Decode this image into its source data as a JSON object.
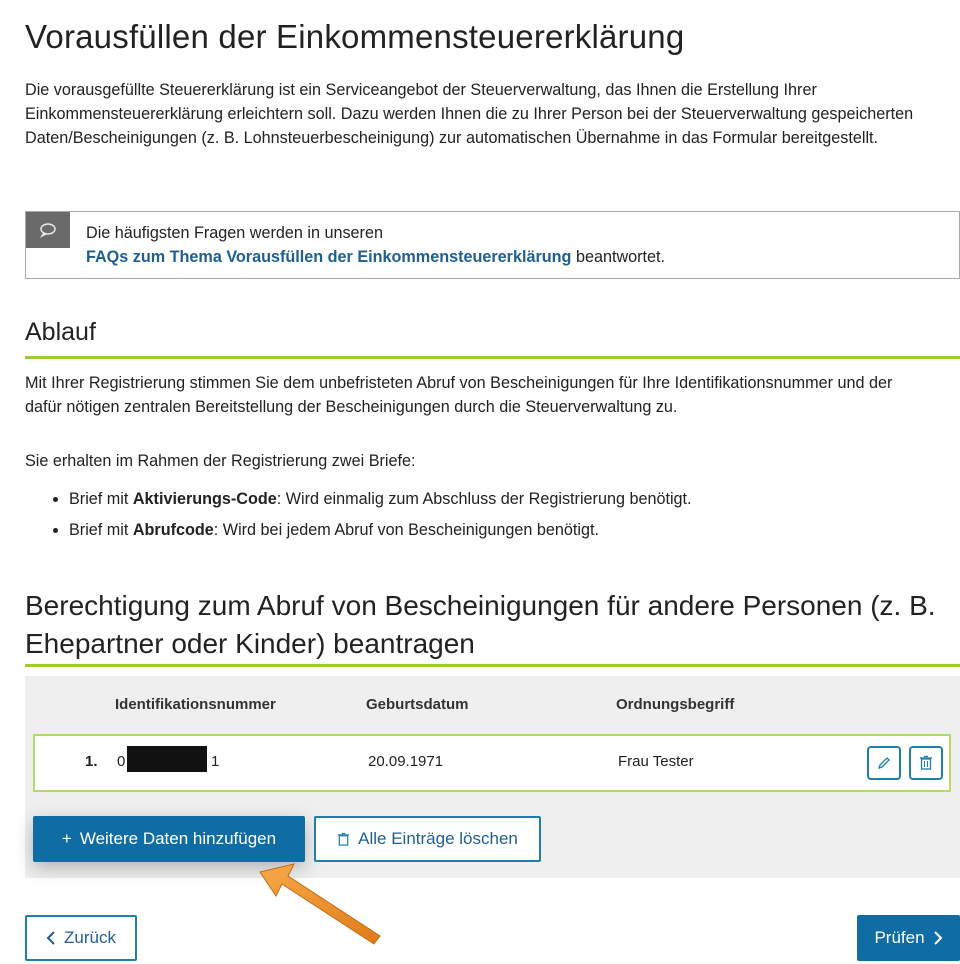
{
  "page": {
    "title": "Vorausfüllen der Einkommensteuererklärung",
    "intro": "Die vorausgefüllte Steuererklärung ist ein Serviceangebot der Steuerverwaltung, das Ihnen die Erstellung Ihrer Einkommensteuererklärung erleichtern soll. Dazu werden Ihnen die zu Ihrer Person bei der Steuerverwaltung gespeicherten Daten/Bescheinigungen (z. B. Lohnsteuerbescheinigung) zur automatischen Übernahme in das Formular bereitgestellt."
  },
  "infobox": {
    "icon": "speech-bubble-icon",
    "line1": "Die häufigsten Fragen werden in unseren",
    "link": "FAQs zum Thema Vorausfüllen der Einkommensteuererklärung",
    "line2_suffix": " beantwortet."
  },
  "ablauf": {
    "heading": "Ablauf",
    "text": "Mit Ihrer Registrierung stimmen Sie dem unbefristeten Abruf von Bescheinigungen für Ihre Identifikationsnummer und der dafür nötigen zentralen Bereitstellung der Bescheinigungen durch die Steuerverwaltung zu.",
    "text2": "Sie erhalten im Rahmen der Registrierung zwei Briefe:",
    "items": [
      {
        "prefix": "Brief mit ",
        "bold": "Aktivierungs-Code",
        "suffix": ": Wird einmalig zum Abschluss der Registrierung benötigt."
      },
      {
        "prefix": "Brief mit ",
        "bold": "Abrufcode",
        "suffix": ": Wird bei jedem Abruf von Bescheinigungen benötigt."
      }
    ]
  },
  "berechtigung": {
    "heading": "Berechtigung zum Abruf von Bescheinigungen für andere Personen (z. B. Ehepartner oder Kinder) beantragen",
    "columns": [
      "Identifikationsnummer",
      "Geburtsdatum",
      "Ordnungsbegriff"
    ],
    "rows": [
      {
        "index": "1.",
        "id_start": "0",
        "id_end": "1",
        "dob": "20.09.1971",
        "ord": "Frau Tester"
      }
    ],
    "add_button": "Weitere Daten hinzufügen",
    "add_icon": "+",
    "clear_button": "Alle Einträge löschen"
  },
  "nav": {
    "back": "Zurück",
    "next": "Prüfen"
  },
  "colors": {
    "accent": "#0f6da3",
    "green": "#9acd32",
    "arrow": "#f08a24"
  }
}
